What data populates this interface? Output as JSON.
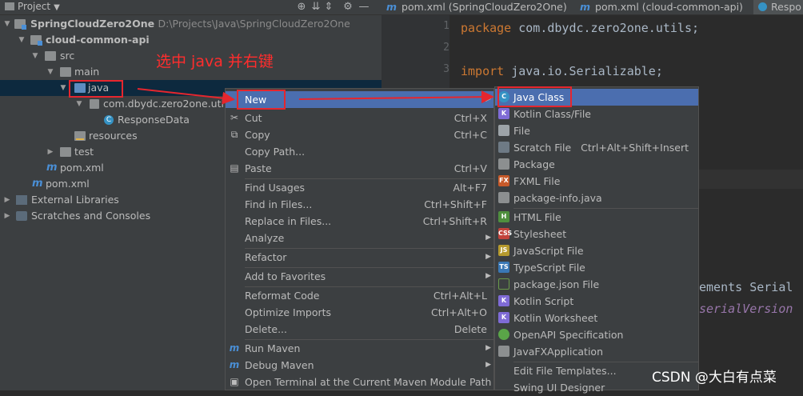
{
  "project_panel": {
    "title": "Project",
    "tree": [
      {
        "label": "SpringCloudZero2One",
        "path": "D:\\Projects\\Java\\SpringCloudZero2One",
        "icon": "module-folder-icon"
      },
      {
        "label": "cloud-common-api",
        "icon": "module-folder-icon"
      },
      {
        "label": "src",
        "icon": "folder-icon"
      },
      {
        "label": "main",
        "icon": "folder-icon"
      },
      {
        "label": "java",
        "icon": "source-folder-icon"
      },
      {
        "label": "com.dbydc.zero2one.utils",
        "icon": "package-icon"
      },
      {
        "label": "ResponseData",
        "icon": "class-icon"
      },
      {
        "label": "resources",
        "icon": "resources-folder-icon"
      },
      {
        "label": "test",
        "icon": "folder-icon"
      },
      {
        "label": "pom.xml",
        "icon": "maven-icon"
      },
      {
        "label": "pom.xml",
        "icon": "maven-icon"
      },
      {
        "label": "External Libraries",
        "icon": "library-icon"
      },
      {
        "label": "Scratches and Consoles",
        "icon": "scratch-icon"
      }
    ]
  },
  "editor": {
    "tabs": [
      {
        "label": "pom.xml (SpringCloudZero2One)"
      },
      {
        "label": "pom.xml (cloud-common-api)"
      },
      {
        "label": "Respo"
      }
    ],
    "line_numbers": [
      "1",
      "2",
      "3"
    ],
    "code": {
      "line1_kw": "package",
      "line1_rest": " com.dbydc.zero2one.utils;",
      "line3_kw": "import",
      "line3_rest": " java.io.Serializable;",
      "fragment1": "ements Serial",
      "fragment2": "serialVersion"
    }
  },
  "context_menu": {
    "items": [
      {
        "label": "New"
      },
      {
        "label": "Cut",
        "shortcut": "Ctrl+X"
      },
      {
        "label": "Copy",
        "shortcut": "Ctrl+C"
      },
      {
        "label": "Copy Path..."
      },
      {
        "label": "Paste",
        "shortcut": "Ctrl+V"
      },
      {
        "label": "Find Usages",
        "shortcut": "Alt+F7"
      },
      {
        "label": "Find in Files...",
        "shortcut": "Ctrl+Shift+F"
      },
      {
        "label": "Replace in Files...",
        "shortcut": "Ctrl+Shift+R"
      },
      {
        "label": "Analyze"
      },
      {
        "label": "Refactor"
      },
      {
        "label": "Add to Favorites"
      },
      {
        "label": "Reformat Code",
        "shortcut": "Ctrl+Alt+L"
      },
      {
        "label": "Optimize Imports",
        "shortcut": "Ctrl+Alt+O"
      },
      {
        "label": "Delete...",
        "shortcut": "Delete"
      },
      {
        "label": "Run Maven"
      },
      {
        "label": "Debug Maven"
      },
      {
        "label": "Open Terminal at the Current Maven Module Path"
      }
    ]
  },
  "submenu": {
    "items": [
      {
        "label": "Java Class"
      },
      {
        "label": "Kotlin Class/File"
      },
      {
        "label": "File"
      },
      {
        "label": "Scratch File",
        "shortcut": "Ctrl+Alt+Shift+Insert"
      },
      {
        "label": "Package"
      },
      {
        "label": "FXML File"
      },
      {
        "label": "package-info.java"
      },
      {
        "label": "HTML File"
      },
      {
        "label": "Stylesheet"
      },
      {
        "label": "JavaScript File"
      },
      {
        "label": "TypeScript File"
      },
      {
        "label": "package.json File"
      },
      {
        "label": "Kotlin Script"
      },
      {
        "label": "Kotlin Worksheet"
      },
      {
        "label": "OpenAPI Specification"
      },
      {
        "label": "JavaFXApplication"
      },
      {
        "label": "Edit File Templates..."
      },
      {
        "label": "Swing UI Designer"
      }
    ]
  },
  "annotation": "选中 java 并右键",
  "watermark": "CSDN @大白有点菜",
  "colors": {
    "accent": "#4b6eaf",
    "annotation": "#e5262e",
    "selection": "#0d293e"
  }
}
